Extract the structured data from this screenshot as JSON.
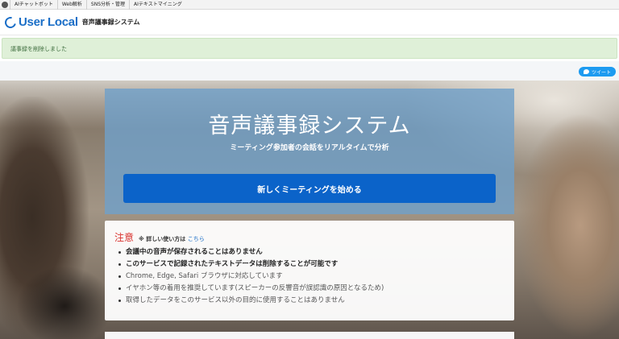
{
  "topbar": {
    "items": [
      "AIチャットボット",
      "Web解析",
      "SNS分析・管理",
      "AIテキストマイニング"
    ]
  },
  "header": {
    "logo_text": "User Local",
    "logo_sub": "音声議事録システム"
  },
  "flash": {
    "message": "議事録を削除しました"
  },
  "tweet": {
    "label": "ツイート"
  },
  "hero": {
    "title": "音声議事録システム",
    "subtitle": "ミーティング参加者の会話をリアルタイムで分析",
    "start_button": "新しくミーティングを始める"
  },
  "notice": {
    "title": "注意",
    "help_prefix": "※ 詳しい使い方は",
    "help_link": "こちら",
    "items": [
      "会議中の音声が保存されることはありません",
      "このサービスで記録されたテキストデータは削除することが可能です",
      "Chrome, Edge, Safari ブラウザに対応しています",
      "イヤホン等の着用を推奨しています(スピーカーの反響音が誤認識の原因となるため)",
      "取得したデータをこのサービス以外の目的に使用することはありません"
    ]
  },
  "colors": {
    "brand": "#1a6ec7",
    "start_button": "#0b63c9",
    "notice_title": "#d9322e",
    "flash_bg": "#dff0d8"
  }
}
